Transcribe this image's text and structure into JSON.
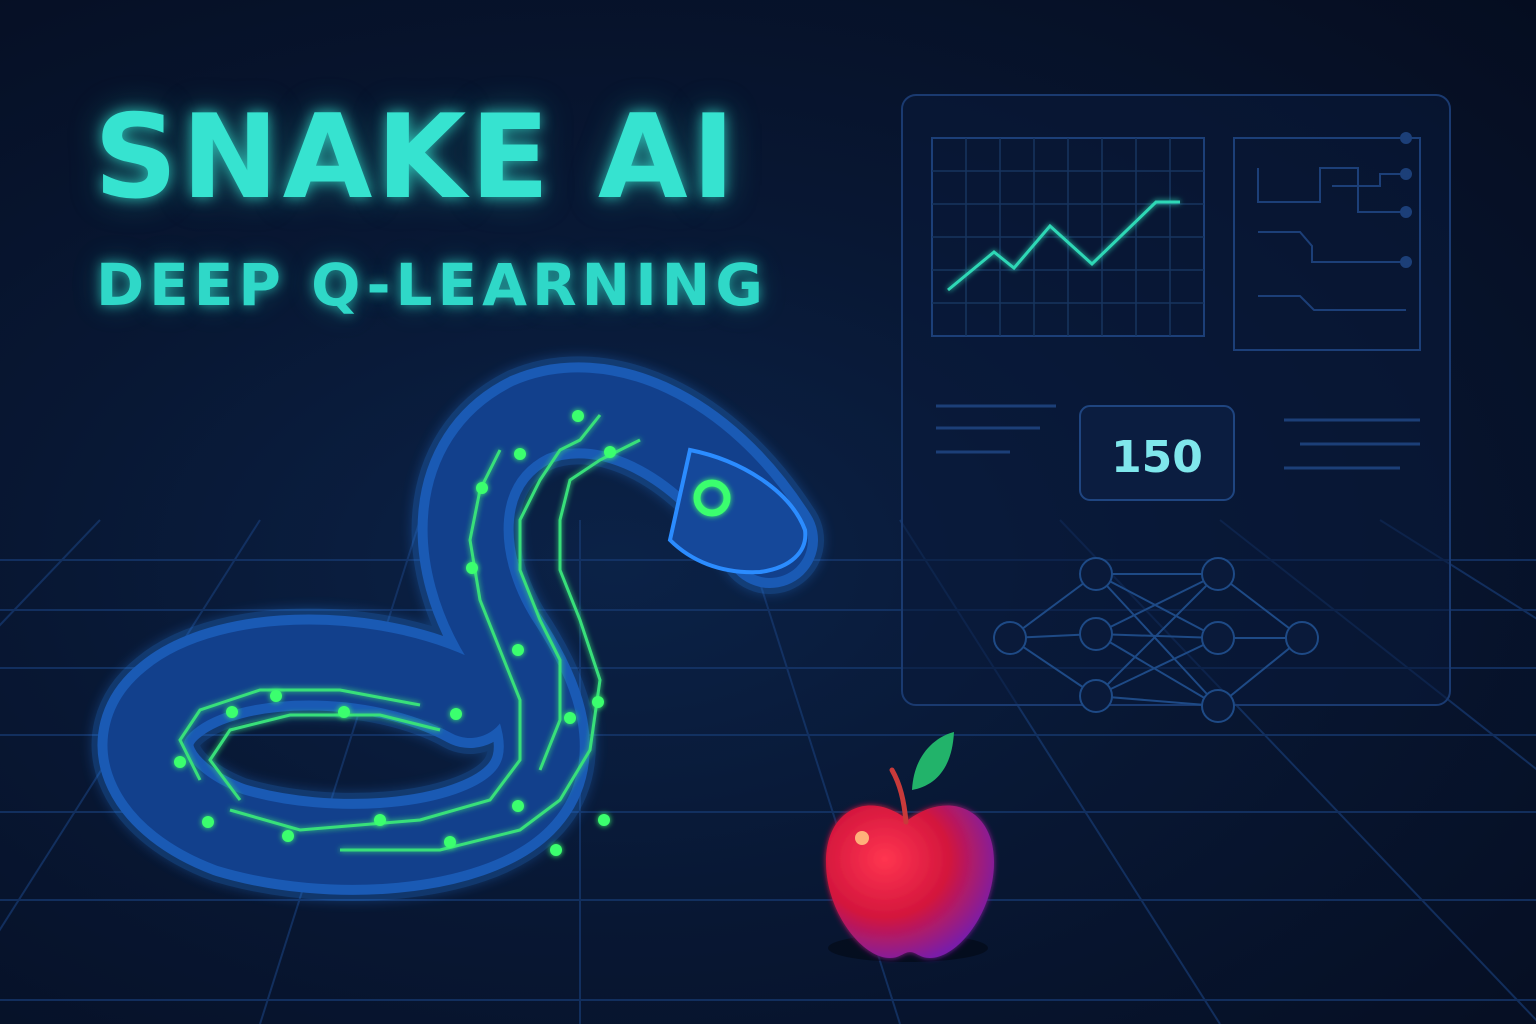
{
  "title": "SNAKE AI",
  "subtitle": "DEEP Q-LEARNING",
  "dashboard": {
    "score_value": "150"
  },
  "colors": {
    "title": "#36e3d0",
    "snake_body": "#1d6fd1",
    "snake_circuit": "#38e07a",
    "apple": "#e0203e",
    "leaf": "#22b36a",
    "panel_lines": "#173a72",
    "chart_line": "#2fd8b6"
  },
  "icons": {
    "snake": "snake-icon",
    "apple": "apple-icon",
    "line_chart": "line-chart-icon",
    "circuit": "circuit-icon",
    "neural_network": "neural-network-icon"
  }
}
